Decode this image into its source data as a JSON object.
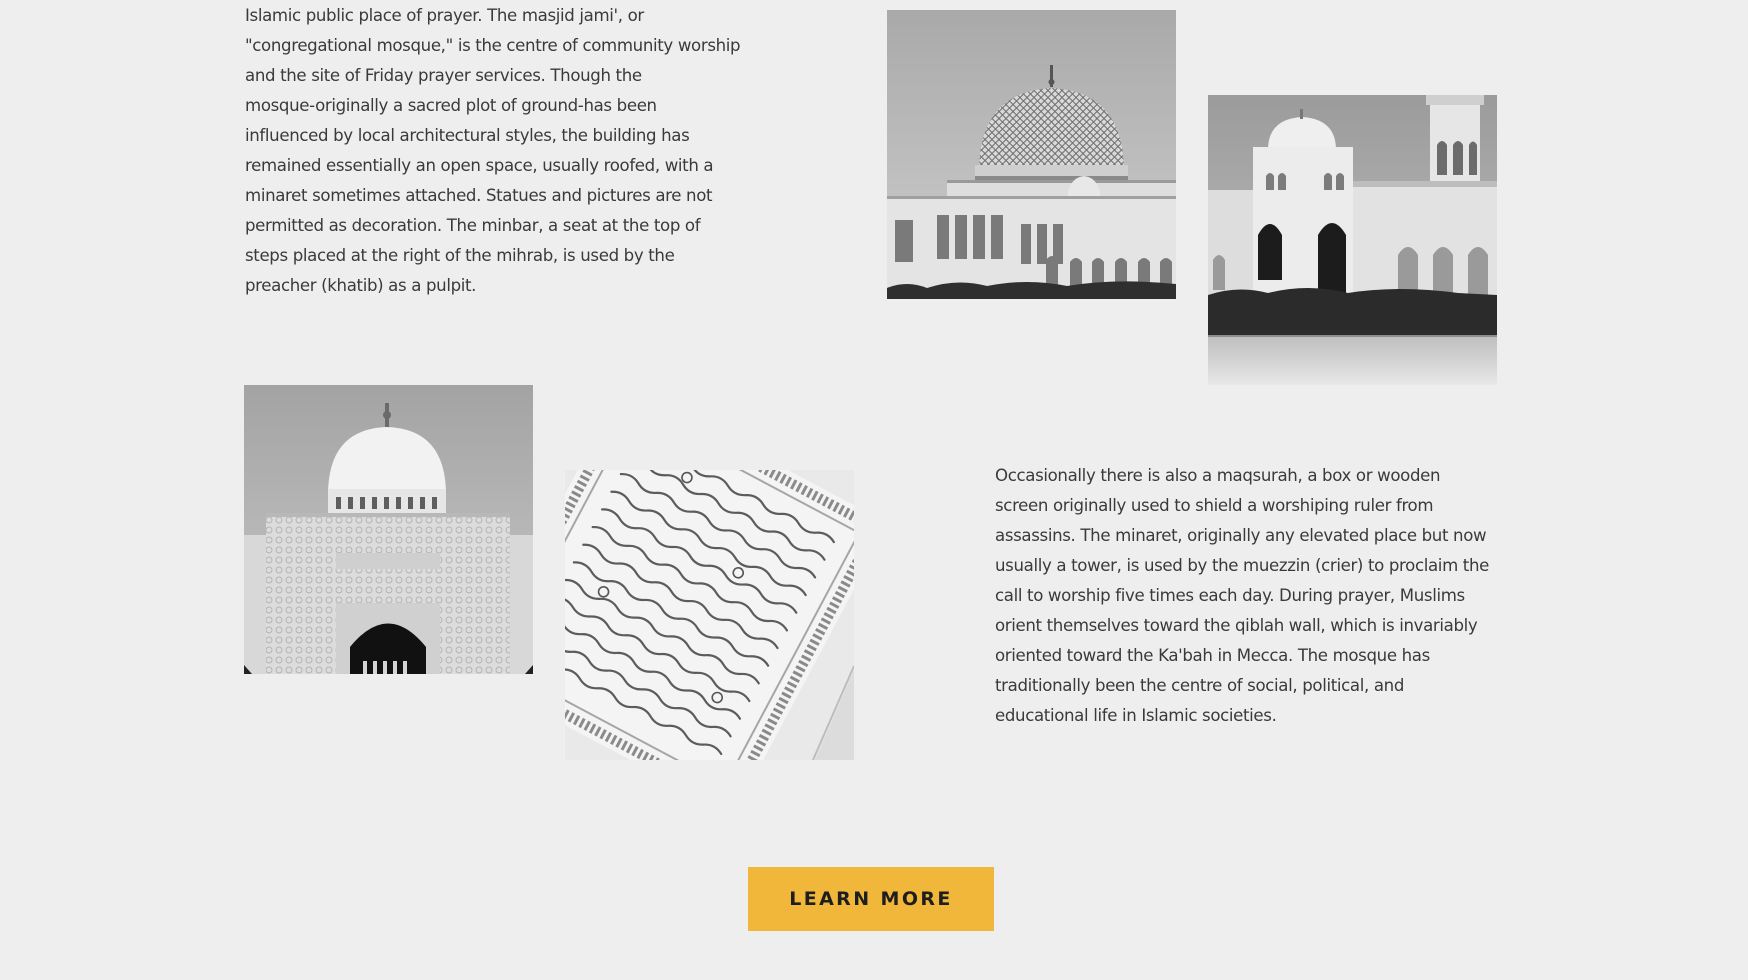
{
  "content": {
    "paragraph_1": "Islamic public place of prayer. The masjid jami', or\n\"congregational mosque,\" is the centre of community worship\nand the site of Friday prayer services. Though the\nmosque-originally a sacred plot of ground-has been\ninfluenced by local architectural styles, the building has\nremained essentially an open space, usually roofed, with a\nminaret sometimes attached. Statues and pictures are not\npermitted as decoration. The minbar, a seat at the top of\nsteps placed at the right of the mihrab, is used by the\npreacher (khatib) as a pulpit.",
    "paragraph_2": "Occasionally there is also a maqsurah, a box or wooden\nscreen originally used to shield a worshiping ruler from\nassassins. The minaret, originally any elevated place but now\nusually a tower, is used by the muezzin (crier) to proclaim the\ncall to worship five times each day. During prayer, Muslims\norient themselves toward the qiblah wall, which is invariably\noriented toward the Ka'bah in Mecca. The mosque has\ntraditionally been the centre of social, political, and\neducational life in Islamic societies."
  },
  "cta": {
    "label": "LEARN MORE",
    "color": "#f1b73a"
  },
  "images": [
    {
      "icon": "mosque-dome-photo"
    },
    {
      "icon": "mosque-courtyard-photo"
    },
    {
      "icon": "mosque-dome-gate-photo"
    },
    {
      "icon": "quran-pages-photo"
    }
  ],
  "colors": {
    "background": "#eeeeee",
    "text": "#3a3a3a"
  }
}
